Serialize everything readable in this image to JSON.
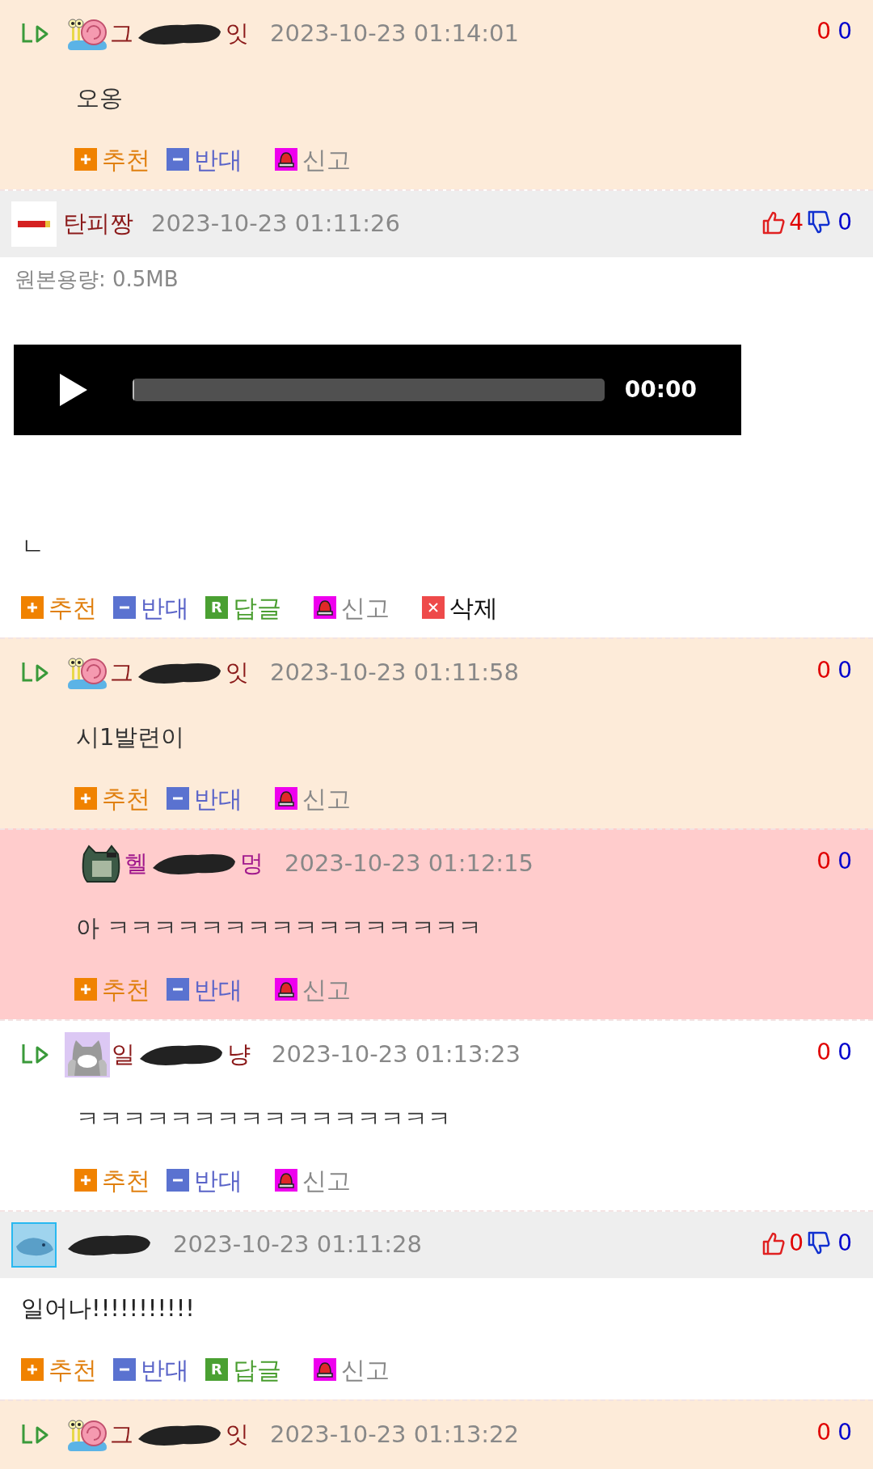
{
  "comments": [
    {
      "kind": "reply",
      "color": "#fdebd9",
      "avatar": {
        "kind": "snail"
      },
      "name": {
        "parts": [
          "그",
          "잇"
        ],
        "color": "#8b1a1a"
      },
      "date": "2023-10-23 01:14:01",
      "up": "0",
      "down": "0",
      "text": "오옹",
      "actions": [
        {
          "kind": "recommend",
          "label": "추천"
        },
        {
          "kind": "oppose",
          "label": "반대"
        },
        {
          "kind": "report",
          "label": "신고"
        }
      ]
    },
    {
      "kind": "top",
      "avatar": {
        "kind": "shell"
      },
      "name": {
        "parts": [
          "탄피짱"
        ],
        "color": "#8b1a1a"
      },
      "date": "2023-10-23 01:11:26",
      "up": "4",
      "down": "0",
      "file_size": "원본용량: 0.5MB",
      "audio": {
        "time": "00:00",
        "level": 0
      },
      "text": "ㄴ",
      "actions": [
        {
          "kind": "recommend",
          "label": "추천"
        },
        {
          "kind": "oppose",
          "label": "반대"
        },
        {
          "kind": "reply",
          "label": "답글",
          "badge": "R"
        },
        {
          "kind": "report",
          "label": "신고"
        },
        {
          "kind": "delete",
          "label": "삭제"
        }
      ]
    },
    {
      "kind": "reply",
      "color": "#fdebd9",
      "avatar": {
        "kind": "snail"
      },
      "name": {
        "parts": [
          "그",
          "잇"
        ],
        "color": "#8b1a1a"
      },
      "date": "2023-10-23 01:11:58",
      "up": "0",
      "down": "0",
      "text": "시1발련이",
      "actions": [
        {
          "kind": "recommend",
          "label": "추천"
        },
        {
          "kind": "oppose",
          "label": "반대"
        },
        {
          "kind": "report",
          "label": "신고"
        }
      ]
    },
    {
      "kind": "nested",
      "color": "#ffcccc",
      "avatar": {
        "kind": "creature"
      },
      "name": {
        "parts": [
          "헬",
          "멍"
        ],
        "color": "#a0188c"
      },
      "date": "2023-10-23 01:12:15",
      "up": "0",
      "down": "0",
      "text": "아 ㅋㅋㅋㅋㅋㅋㅋㅋㅋㅋㅋㅋㅋㅋㅋㅋ",
      "actions": [
        {
          "kind": "recommend",
          "label": "추천"
        },
        {
          "kind": "oppose",
          "label": "반대"
        },
        {
          "kind": "report",
          "label": "신고"
        }
      ]
    },
    {
      "kind": "reply",
      "color": "#ffffff",
      "avatar": {
        "kind": "cat"
      },
      "name": {
        "parts": [
          "일",
          "냥"
        ],
        "color": "#8b1a1a"
      },
      "date": "2023-10-23 01:13:23",
      "up": "0",
      "down": "0",
      "text": "ㅋㅋㅋㅋㅋㅋㅋㅋㅋㅋㅋㅋㅋㅋㅋㅋ",
      "actions": [
        {
          "kind": "recommend",
          "label": "추천"
        },
        {
          "kind": "oppose",
          "label": "반대"
        },
        {
          "kind": "report",
          "label": "신고"
        }
      ]
    },
    {
      "kind": "top",
      "avatar": {
        "kind": "fish"
      },
      "date": "2023-10-23 01:11:28",
      "up": "0",
      "down": "0",
      "text": "일어나!!!!!!!!!!!",
      "actions": [
        {
          "kind": "recommend",
          "label": "추천"
        },
        {
          "kind": "oppose",
          "label": "반대"
        },
        {
          "kind": "reply",
          "label": "답글",
          "badge": "R"
        },
        {
          "kind": "report",
          "label": "신고"
        }
      ]
    },
    {
      "kind": "reply",
      "color": "#fdebd9",
      "avatar": {
        "kind": "snail"
      },
      "name": {
        "parts": [
          "그",
          "잇"
        ],
        "color": "#8b1a1a"
      },
      "date": "2023-10-23 01:13:22",
      "up": "0",
      "down": "0"
    }
  ]
}
